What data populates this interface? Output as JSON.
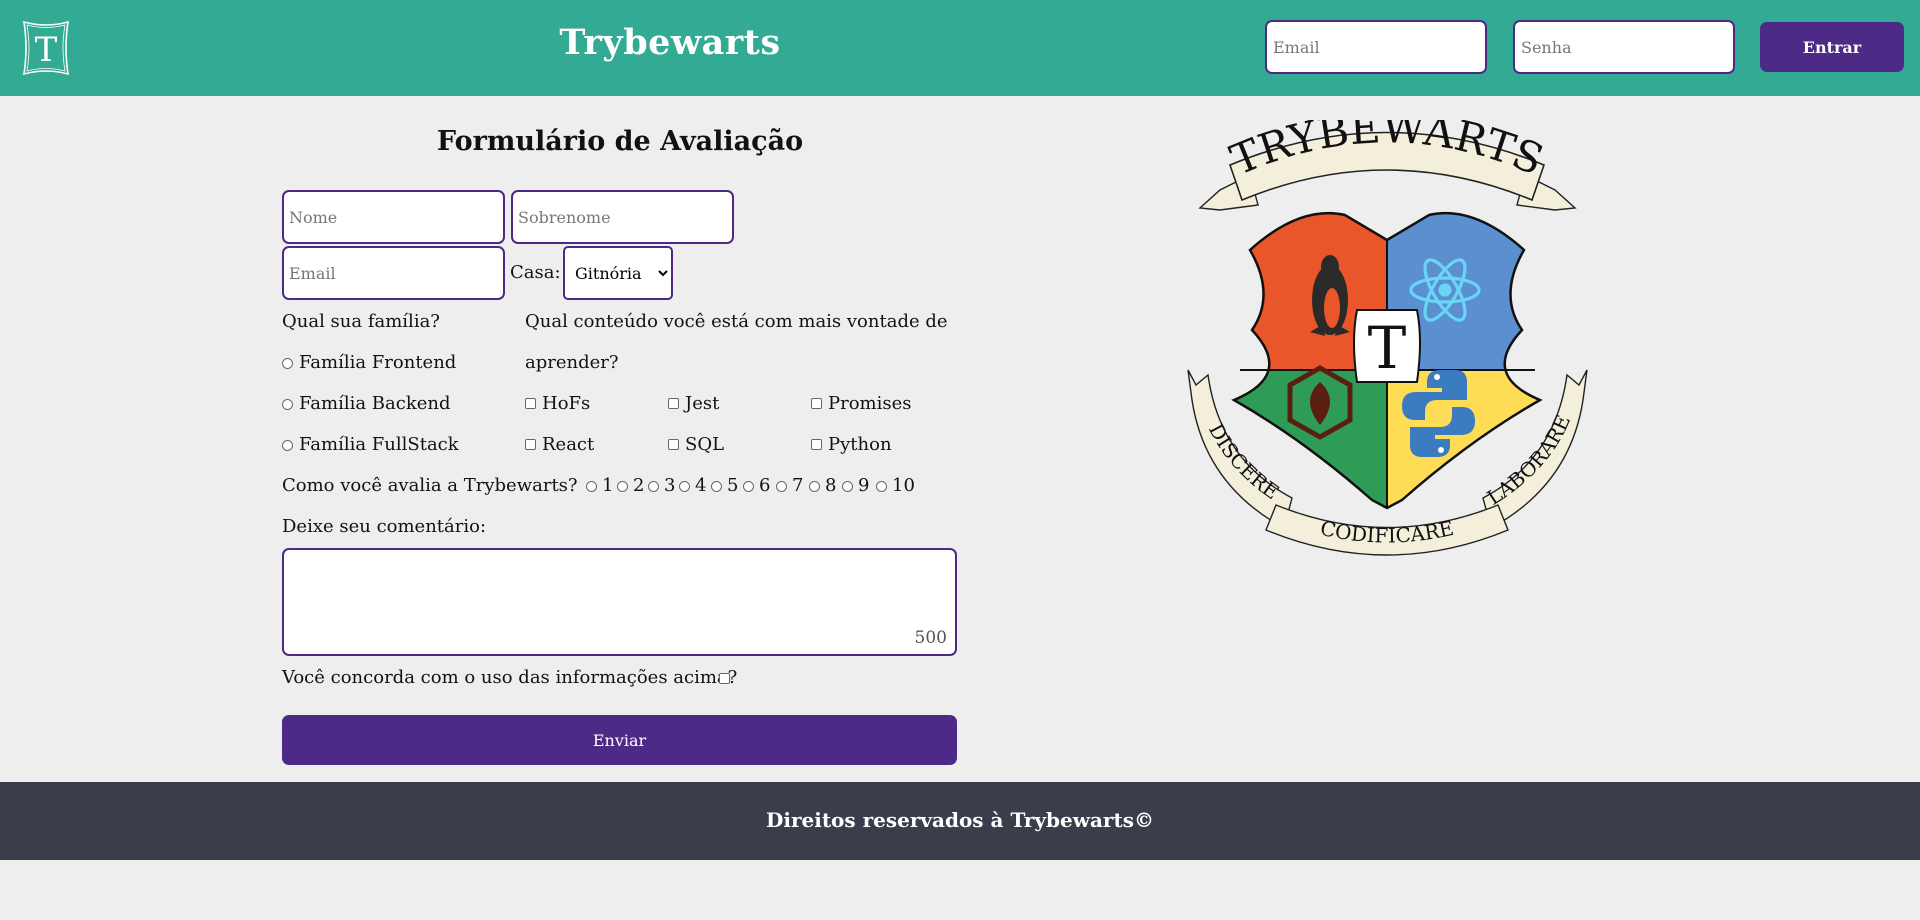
{
  "header": {
    "logo_letter": "T",
    "title": "Trybewarts",
    "email_placeholder": "Email",
    "password_placeholder": "Senha",
    "login_label": "Entrar"
  },
  "form": {
    "title": "Formulário de Avaliação",
    "nome_placeholder": "Nome",
    "sobrenome_placeholder": "Sobrenome",
    "email_placeholder": "Email",
    "casa_label": "Casa:",
    "casa_selected": "Gitnória",
    "family_question": "Qual sua família?",
    "families": [
      "Família Frontend",
      "Família Backend",
      "Família FullStack"
    ],
    "content_question_line1": "Qual conteúdo você está com mais vontade de",
    "content_question_line2": "aprender?",
    "subjects": [
      "HoFs",
      "Jest",
      "Promises",
      "React",
      "SQL",
      "Python"
    ],
    "rate_question": "Como você avalia a Trybewarts?",
    "ratings": [
      "1",
      "2",
      "3",
      "4",
      "5",
      "6",
      "7",
      "8",
      "9",
      "10"
    ],
    "comment_label": "Deixe seu comentário:",
    "comment_counter": "500",
    "agreement_label": "Você concorda com o uso das informações acima?",
    "submit_label": "Enviar"
  },
  "crest": {
    "banner_title": "TRYBEWARTS",
    "shield_letter": "T",
    "motto_left": "DISCERE",
    "motto_center": "CODIFICARE",
    "motto_right": "LABORARE"
  },
  "colors": {
    "header_bg": "#33aa93",
    "accent_purple": "#4c2a85",
    "footer_bg": "#3b3e4a",
    "page_bg": "#eeeeee"
  },
  "footer": {
    "text": "Direitos reservados à Trybewarts©"
  }
}
